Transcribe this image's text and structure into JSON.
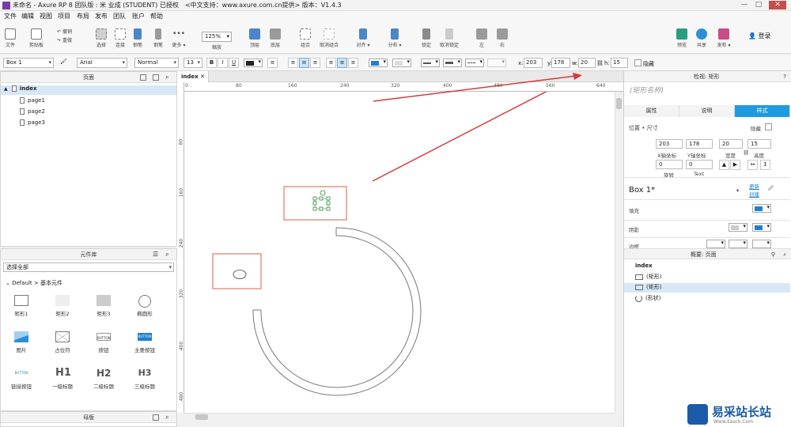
{
  "window": {
    "title": "未命名 - Axure RP 8 团队版 : 米 业成 (STUDENT) 已授权　<中文支持：www.axure.com.cn提供> 版本：V1.4.3",
    "min": "—",
    "max": "□",
    "close": "✕"
  },
  "menu": [
    "文件",
    "编辑",
    "视图",
    "项目",
    "布局",
    "发布",
    "团队",
    "账户",
    "帮助"
  ],
  "toolbar": {
    "file": "文件",
    "clipboard": "剪贴板",
    "undo": "撤销",
    "redo": "重做",
    "select": "选择",
    "connect": "连接",
    "pen": "钢笔",
    "more": "更多 ▾",
    "zoom_value": "125%",
    "zoom_label": "缩放",
    "top": "顶层",
    "bottom": "底层",
    "group": "组合",
    "ungroup": "取消组合",
    "align": "对齐 ▾",
    "distribute": "分布 ▾",
    "lock": "锁定",
    "unlock": "取消锁定",
    "left": "左",
    "right": "右",
    "preview": "预览",
    "share": "共享",
    "publish": "发布 ▾",
    "login": "登录"
  },
  "format": {
    "widget_name": "Box 1",
    "font": "Arial",
    "weight": "Normal",
    "size": "13",
    "bold": "B",
    "italic": "I",
    "underline": "U",
    "x_label": "x:",
    "x": "203",
    "y_label": "y:",
    "y": "178",
    "w_label": "w:",
    "w": "20",
    "h_label": "h:",
    "h": "15",
    "hidden": "隐藏"
  },
  "pages_panel": {
    "title": "页面",
    "root": "index",
    "pages": [
      "page1",
      "page2",
      "page3"
    ]
  },
  "library_panel": {
    "title": "元件库",
    "filter": "选择全部",
    "group": "Default > 基本元件",
    "widgets": [
      {
        "label": "矩形1",
        "icon": "rect-icon"
      },
      {
        "label": "矩形2",
        "icon": "rect-gray-icon"
      },
      {
        "label": "矩形3",
        "icon": "rect-dark-icon"
      },
      {
        "label": "椭圆形",
        "icon": "ellipse-icon"
      },
      {
        "label": "图片",
        "icon": "image-icon"
      },
      {
        "label": "占位符",
        "icon": "placeholder-icon"
      },
      {
        "label": "按钮",
        "icon": "button-icon",
        "text": "BUTTON"
      },
      {
        "label": "主要按钮",
        "icon": "primary-button-icon",
        "text": "BUTTON"
      },
      {
        "label": "链接按钮",
        "icon": "link-button-icon",
        "text": "BUTTON"
      },
      {
        "label": "一级标题",
        "icon": "h1-icon",
        "text": "H1"
      },
      {
        "label": "二级标题",
        "icon": "h2-icon",
        "text": "H2"
      },
      {
        "label": "三级标题",
        "icon": "h3-icon",
        "text": "H3"
      }
    ]
  },
  "master_panel": {
    "title": "母版"
  },
  "canvas": {
    "tab": "index",
    "hruler": [
      "0",
      "80",
      "160",
      "240",
      "320",
      "400",
      "480",
      "560",
      "640"
    ],
    "vruler": [
      "80",
      "160",
      "240",
      "320",
      "400",
      "480"
    ]
  },
  "inspector": {
    "title": "检视: 矩形",
    "name_placeholder": "(矩形名称)",
    "tabs": [
      "属性",
      "说明",
      "样式"
    ],
    "active_tab": "样式",
    "section": "位置 • 尺寸",
    "hidden": "隐藏",
    "x": "203",
    "y": "178",
    "w": "20",
    "h": "15",
    "x_lbl": "X轴坐标",
    "y_lbl": "Y轴坐标",
    "w_lbl": "宽度",
    "h_lbl": "高度",
    "rot": "0",
    "text_rot": "0",
    "rot_lbl": "旋转",
    "text_lbl": "Text",
    "style_name": "Box 1*",
    "update": "更新",
    "create": "创建",
    "fill": "填充",
    "shadow": "阴影",
    "border": "边框",
    "fill_color": "#1e80d0"
  },
  "outline": {
    "title": "概要: 页面",
    "root": "index",
    "items": [
      "(矩形)",
      "(矩形)",
      "(形状)"
    ]
  },
  "watermark": {
    "text": "易采站长站",
    "sub": "Www.Easck.Com"
  },
  "colors": {
    "accent": "#1e9be0",
    "selection": "#e25b4a",
    "arrow": "#d63a3a"
  }
}
